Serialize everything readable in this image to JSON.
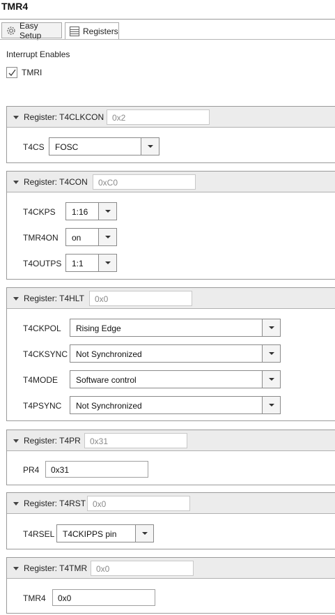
{
  "title": "TMR4",
  "tabs": [
    {
      "label": "Easy Setup",
      "icon": "gear-icon"
    },
    {
      "label": "Registers",
      "icon": "registers-icon"
    }
  ],
  "interrupts": {
    "heading": "Interrupt Enables",
    "tmri_label": "TMRI",
    "tmri_checked": true
  },
  "registers": [
    {
      "label": "Register: T4CLKCON",
      "value": "0x2",
      "fields": [
        {
          "label": "T4CS",
          "value": "FOSC"
        }
      ]
    },
    {
      "label": "Register: T4CON",
      "value": "0xC0",
      "fields": [
        {
          "label": "T4CKPS",
          "value": "1:16"
        },
        {
          "label": "TMR4ON",
          "value": "on"
        },
        {
          "label": "T4OUTPS",
          "value": "1:1"
        }
      ]
    },
    {
      "label": "Register: T4HLT",
      "value": "0x0",
      "fields": [
        {
          "label": "T4CKPOL",
          "value": "Rising Edge"
        },
        {
          "label": "T4CKSYNC",
          "value": "Not Synchronized"
        },
        {
          "label": "T4MODE",
          "value": "Software control"
        },
        {
          "label": "T4PSYNC",
          "value": "Not Synchronized"
        }
      ]
    },
    {
      "label": "Register: T4PR",
      "value": "0x31",
      "fields": [
        {
          "label": "PR4",
          "value": "0x31"
        }
      ]
    },
    {
      "label": "Register: T4RST",
      "value": "0x0",
      "fields": [
        {
          "label": "T4RSEL",
          "value": "T4CKIPPS pin"
        }
      ]
    },
    {
      "label": "Register: T4TMR",
      "value": "0x0",
      "fields": [
        {
          "label": "TMR4",
          "value": "0x0"
        }
      ]
    }
  ]
}
